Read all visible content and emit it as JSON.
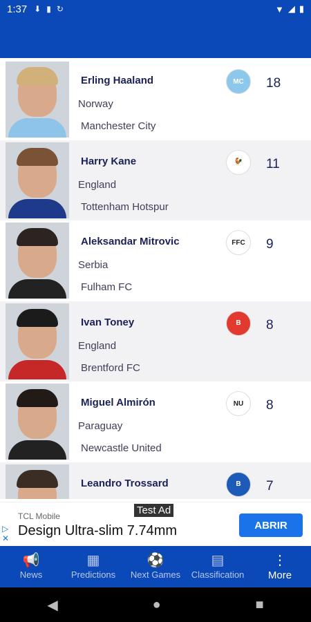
{
  "status_bar": {
    "time": "1:37",
    "icons": [
      "download-icon",
      "sd-card-icon",
      "sync-icon"
    ],
    "right_icons": "▾◢▢"
  },
  "players": [
    {
      "name": "Erling Haaland",
      "country": "Norway",
      "club": "Manchester City",
      "goals": "18",
      "crest_color": "#8bc8ec",
      "crest_text": "MC",
      "shirt": "#8ec3ea",
      "hair": "#d1b07a"
    },
    {
      "name": "Harry Kane",
      "country": "England",
      "club": "Tottenham Hotspur",
      "goals": "11",
      "crest_color": "#ffffff",
      "crest_text": "🐓",
      "shirt": "#1e3a8a",
      "hair": "#7a5236"
    },
    {
      "name": "Aleksandar Mitrovic",
      "country": "Serbia",
      "club": "Fulham FC",
      "goals": "9",
      "crest_color": "#ffffff",
      "crest_text": "FFC",
      "shirt": "#222222",
      "hair": "#2b2421"
    },
    {
      "name": "Ivan Toney",
      "country": "England",
      "club": "Brentford FC",
      "goals": "8",
      "crest_color": "#e23a2e",
      "crest_text": "B",
      "shirt": "#c62828",
      "hair": "#1b1b1b"
    },
    {
      "name": "Miguel Almirón",
      "country": "Paraguay",
      "club": "Newcastle United",
      "goals": "8",
      "crest_color": "#ffffff",
      "crest_text": "NU",
      "shirt": "#222222",
      "hair": "#211a17"
    },
    {
      "name": "Leandro Trossard",
      "country": "",
      "club": "",
      "goals": "7",
      "crest_color": "#1e5bb8",
      "crest_text": "B",
      "shirt": "#ffffff",
      "hair": "#3b2c24"
    }
  ],
  "ad": {
    "label": "Test Ad",
    "advertiser": "TCL Mobile",
    "headline": "Design Ultra-slim 7.74mm",
    "cta": "ABRIR"
  },
  "nav": {
    "items": [
      {
        "label": "News",
        "icon": "📢"
      },
      {
        "label": "Predictions",
        "icon": "▦"
      },
      {
        "label": "Next Games",
        "icon": "⚽"
      },
      {
        "label": "Classification",
        "icon": "▤"
      },
      {
        "label": "More",
        "icon": "⋮"
      }
    ]
  },
  "colors": {
    "primary": "#0b48b8",
    "row_alt": "#f2f2f4",
    "text_dark": "#1b2156"
  }
}
